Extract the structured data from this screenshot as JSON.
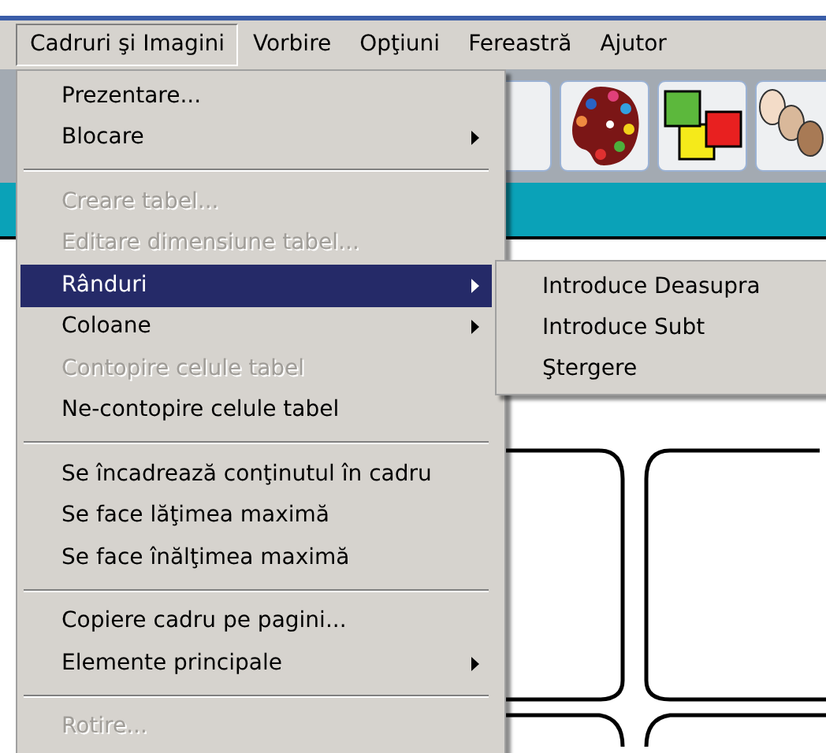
{
  "menu_bar": [
    {
      "label": "Cadruri şi Imagini",
      "selected": true
    },
    {
      "label": "Vorbire",
      "selected": false
    },
    {
      "label": "Opţiuni",
      "selected": false
    },
    {
      "label": "Fereastră",
      "selected": false
    },
    {
      "label": "Ajutor",
      "selected": false
    }
  ],
  "menu": [
    {
      "kind": "item",
      "label": "Prezentare...",
      "disabled": false,
      "submenu": false,
      "selected": false
    },
    {
      "kind": "item",
      "label": "Blocare",
      "disabled": false,
      "submenu": true,
      "selected": false
    },
    {
      "kind": "separator"
    },
    {
      "kind": "item",
      "label": "Creare tabel...",
      "disabled": true,
      "submenu": false,
      "selected": false
    },
    {
      "kind": "item",
      "label": "Editare dimensiune tabel...",
      "disabled": true,
      "submenu": false,
      "selected": false
    },
    {
      "kind": "item",
      "label": "Rânduri",
      "disabled": false,
      "submenu": true,
      "selected": true
    },
    {
      "kind": "item",
      "label": "Coloane",
      "disabled": false,
      "submenu": true,
      "selected": false
    },
    {
      "kind": "item",
      "label": "Contopire celule tabel",
      "disabled": true,
      "submenu": false,
      "selected": false
    },
    {
      "kind": "item",
      "label": "Ne-contopire celule tabel",
      "disabled": false,
      "submenu": false,
      "selected": false
    },
    {
      "kind": "separator"
    },
    {
      "kind": "item",
      "label": "Se încadrează conţinutul în cadru",
      "disabled": false,
      "submenu": false,
      "selected": false
    },
    {
      "kind": "item",
      "label": "Se face lăţimea maximă",
      "disabled": false,
      "submenu": false,
      "selected": false
    },
    {
      "kind": "item",
      "label": "Se face înălţimea maximă",
      "disabled": false,
      "submenu": false,
      "selected": false
    },
    {
      "kind": "separator"
    },
    {
      "kind": "item",
      "label": "Copiere cadru pe pagini...",
      "disabled": false,
      "submenu": false,
      "selected": false
    },
    {
      "kind": "item",
      "label": "Elemente principale",
      "disabled": false,
      "submenu": true,
      "selected": false
    },
    {
      "kind": "separator"
    },
    {
      "kind": "item",
      "label": "Rotire...",
      "disabled": true,
      "submenu": false,
      "selected": false
    }
  ],
  "submenu": [
    {
      "label": "Introduce Deasupra"
    },
    {
      "label": "Introduce Subt"
    },
    {
      "label": "Ştergere"
    }
  ]
}
